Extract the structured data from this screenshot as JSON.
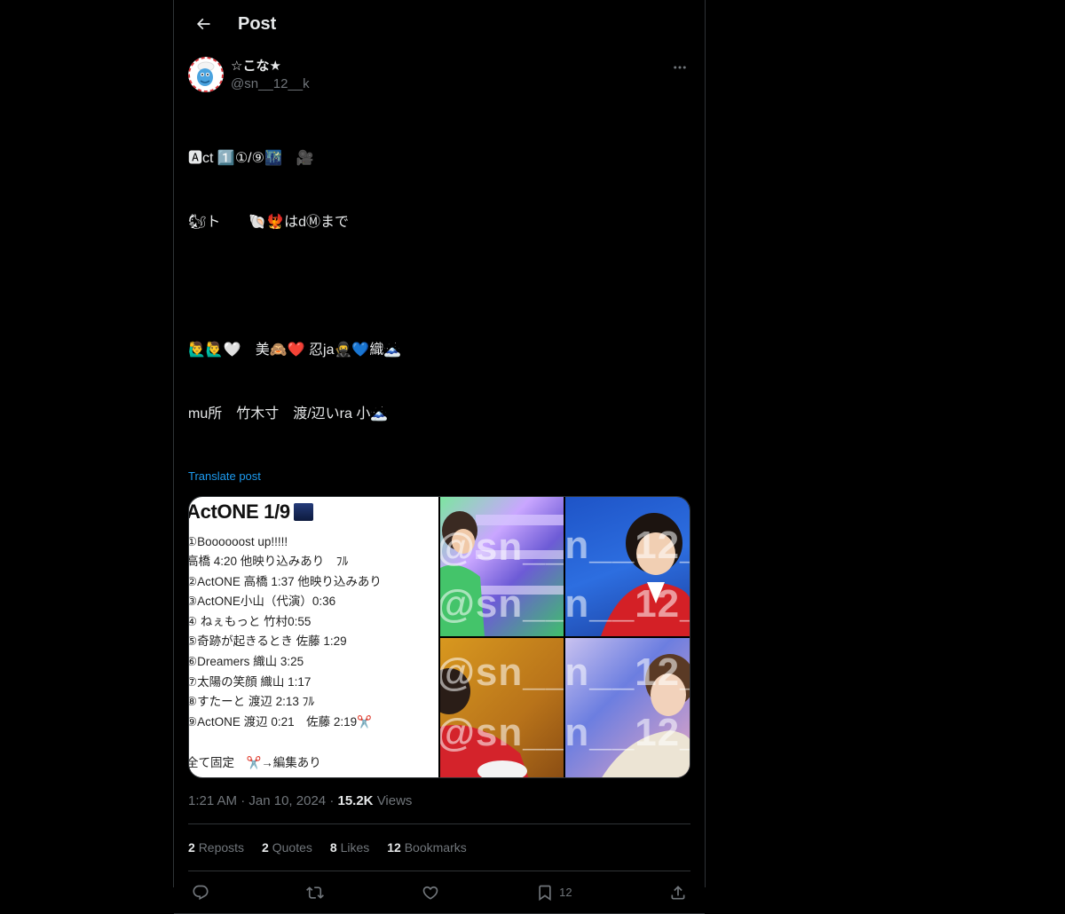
{
  "header": {
    "title": "Post",
    "back_icon": "arrow-left-icon"
  },
  "author": {
    "display_name": "☆こな★",
    "handle": "@sn__12__k",
    "more_icon": "more-horizontal-icon"
  },
  "post": {
    "lines": [
      "🅰ct 1️⃣①/⑨🌃　🎥",
      "🐿ト　　🐚🐦‍🔥はdⓂまで",
      "",
      "🙋‍♂️🙋‍♂️🤍　美🙈❤️ 忍ja🥷💙織🗻",
      "mu所　竹木寸　渡/辺いra 小🗻"
    ],
    "translate_label": "Translate post"
  },
  "media": {
    "setlist_title": "ActONE 1/9",
    "setlist_items": [
      "①Boooooost up!!!!!",
      "高橋 4:20 他映り込みあり　ﾌﾙ",
      "②ActONE 高橋 1:37 他映り込みあり",
      "③ActONE小山（代演）0:36",
      "④ ねぇもっと 竹村0:55",
      "⑤奇跡が起きるとき 佐藤 1:29",
      "⑥Dreamers 織山 3:25",
      "⑦太陽の笑顔 織山 1:17",
      "⑧すたーと 渡辺 2:13 ﾌﾙ",
      "⑨ActONE 渡辺 0:21　佐藤 2:19✂️",
      "",
      "全て固定　✂️→編集あり"
    ],
    "watermark": "@sn__12_k"
  },
  "meta": {
    "time": "1:21 AM",
    "date": "Jan 10, 2024",
    "views_count": "15.2K",
    "views_label": "Views",
    "separator": "·"
  },
  "stats": {
    "reposts_count": "2",
    "reposts_label": "Reposts",
    "quotes_count": "2",
    "quotes_label": "Quotes",
    "likes_count": "8",
    "likes_label": "Likes",
    "bookmarks_count": "12",
    "bookmarks_label": "Bookmarks"
  },
  "actions": {
    "reply_icon": "reply-icon",
    "repost_icon": "repost-icon",
    "like_icon": "heart-icon",
    "bookmark_icon": "bookmark-icon",
    "bookmark_count": "12",
    "share_icon": "share-icon"
  },
  "colors": {
    "accent": "#1d9bf0",
    "muted": "#71767b",
    "border": "#2f3336",
    "background": "#000000"
  }
}
